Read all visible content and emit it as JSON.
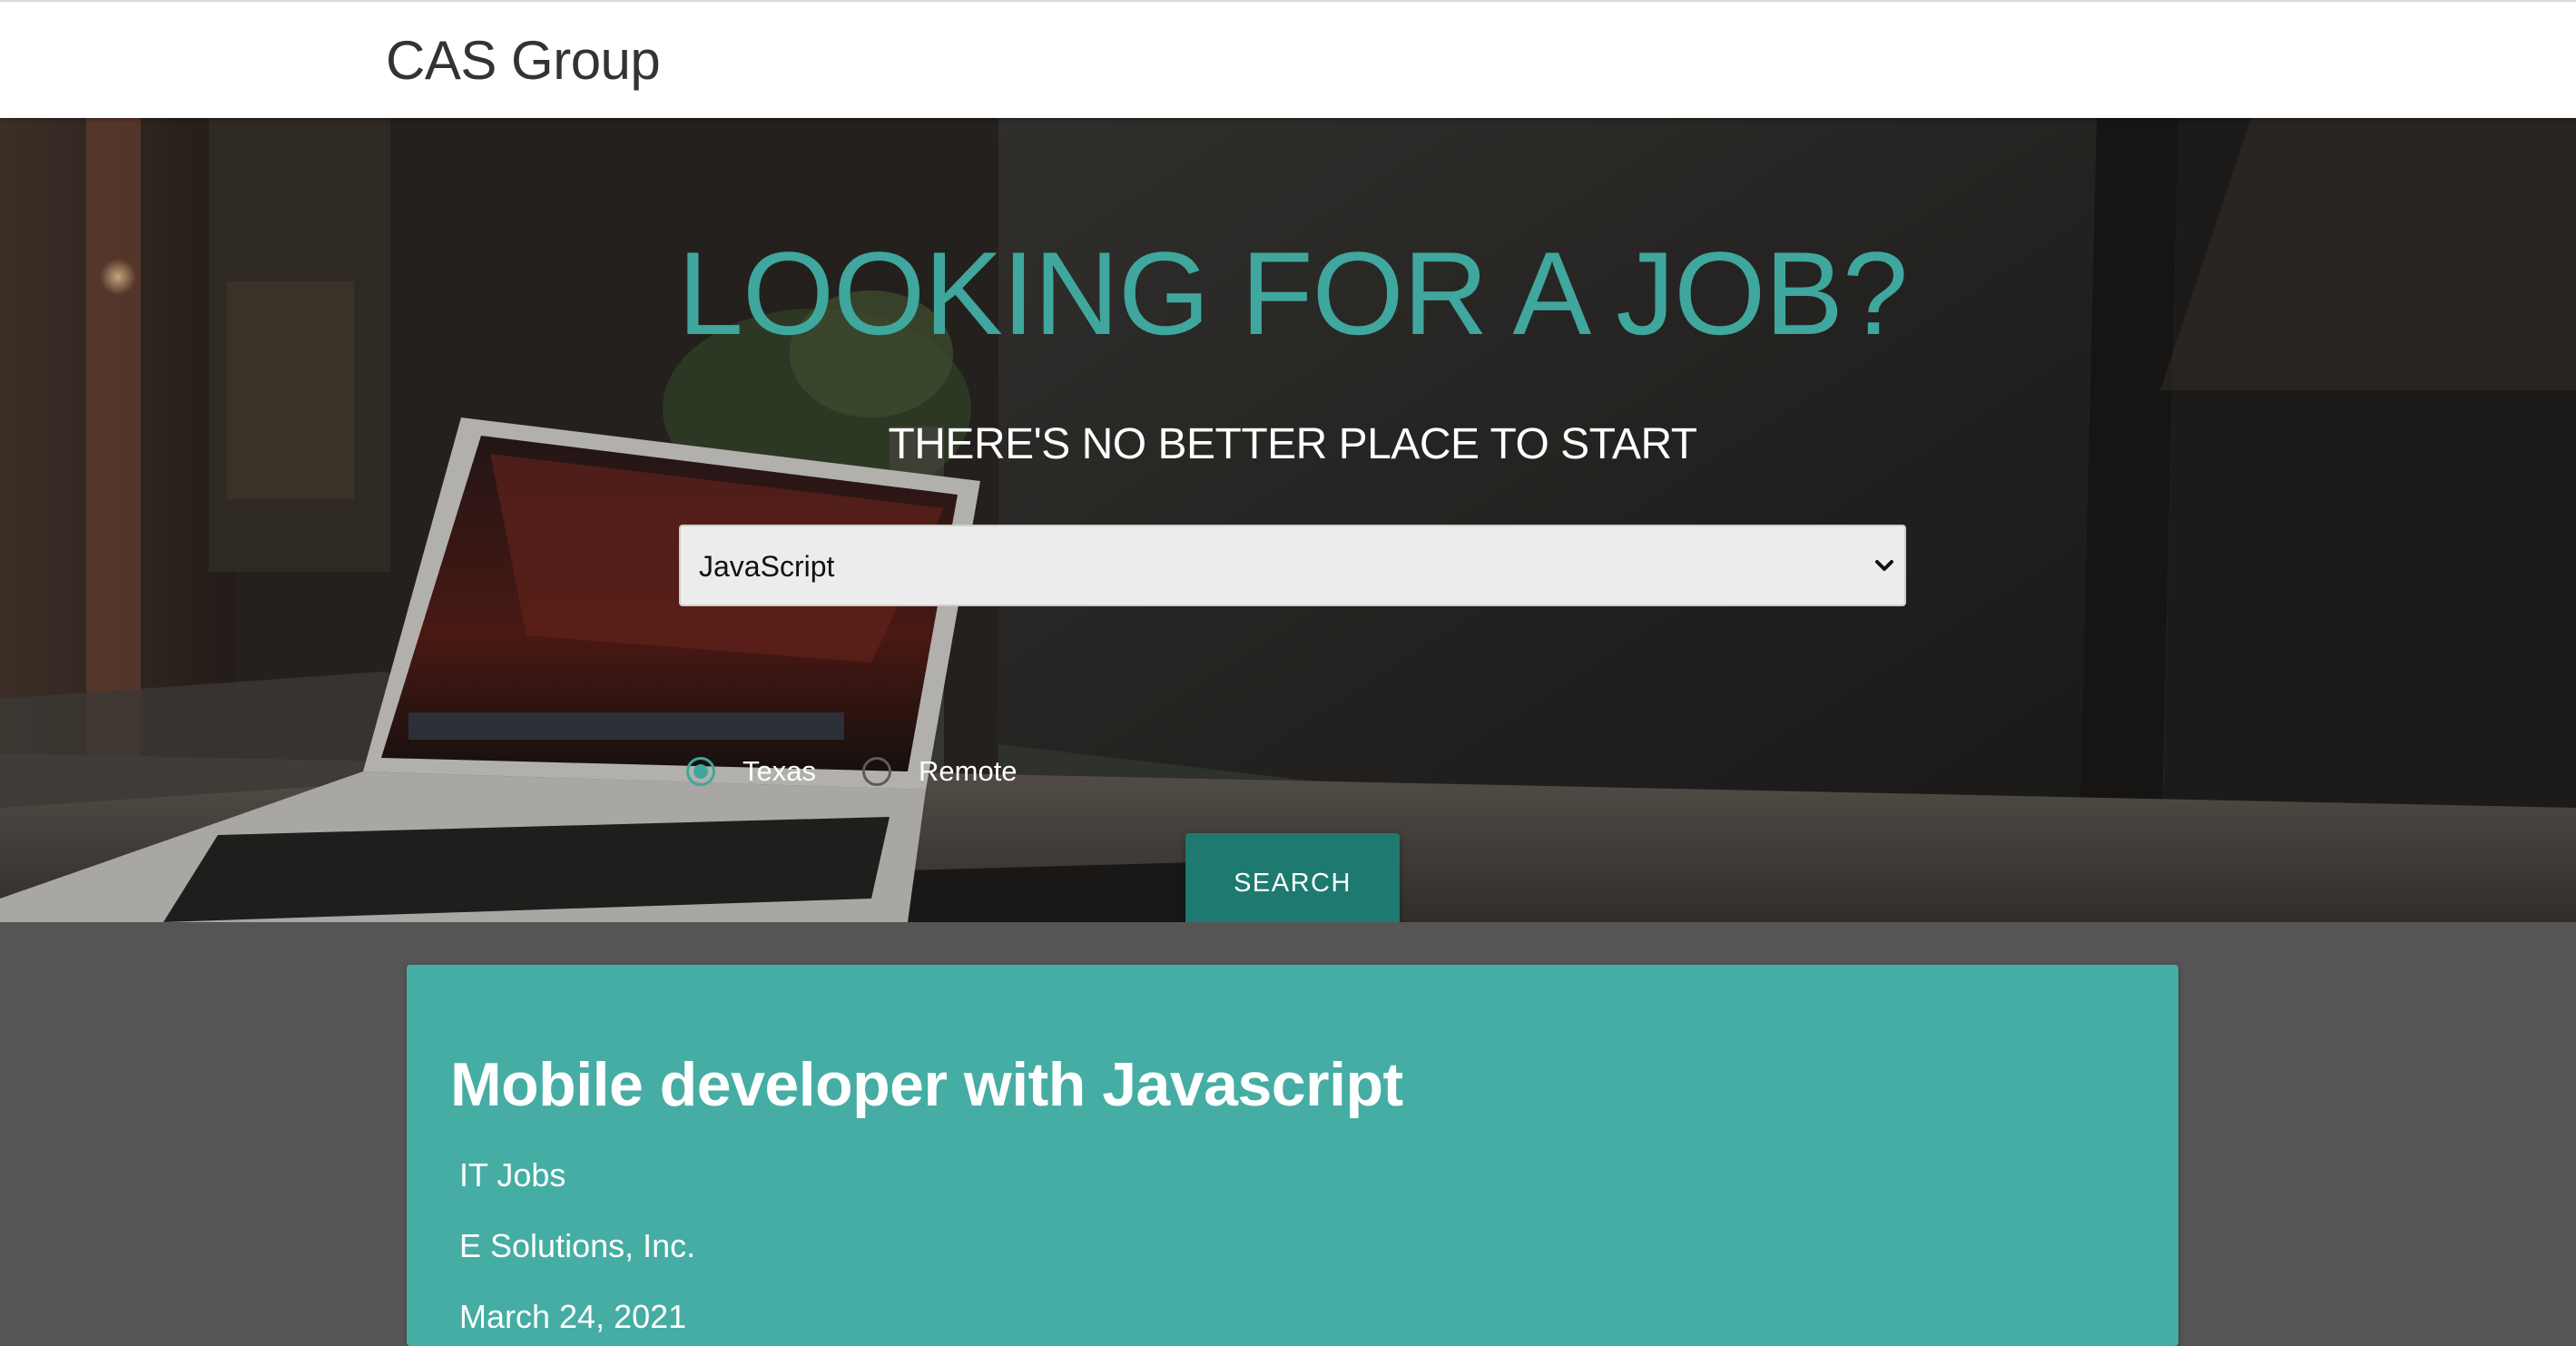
{
  "header": {
    "brand": "CAS Group"
  },
  "hero": {
    "title": "LOOKING FOR A JOB?",
    "subtitle": "THERE'S NO BETTER PLACE TO START",
    "background_image": "laptop-and-monitor-open-sign-photo",
    "skill_select": {
      "selected": "JavaScript"
    },
    "location_options": [
      {
        "label": "Texas",
        "checked": true
      },
      {
        "label": "Remote",
        "checked": false
      }
    ],
    "search_label": "SEARCH"
  },
  "results": [
    {
      "title": "Mobile developer with Javascript",
      "category": "IT Jobs",
      "company": "E Solutions, Inc.",
      "date": "March 24, 2021"
    }
  ],
  "colors": {
    "accent": "#3fa79d",
    "button": "#1e7a70",
    "card": "#45ada3",
    "page_background": "#555555",
    "header_background": "#ffffff"
  },
  "icons": {
    "select_arrow": "chevron-down-icon"
  }
}
